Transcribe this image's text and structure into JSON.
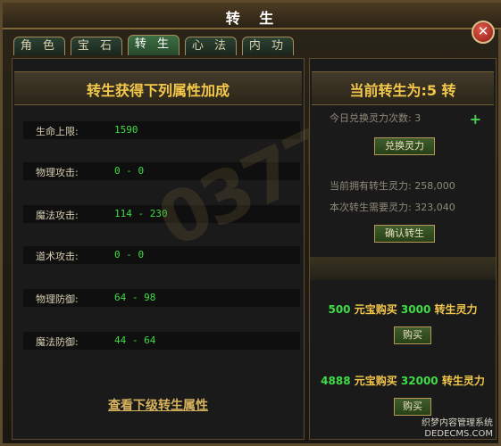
{
  "window": {
    "title": "转 生"
  },
  "tabs": [
    "角 色",
    "宝 石",
    "转 生",
    "心 法",
    "内 功"
  ],
  "left": {
    "header": "转生获得下列属性加成",
    "stats": [
      {
        "label": "生命上限:",
        "value": "1590"
      },
      {
        "label": "物理攻击:",
        "value": "0 - 0"
      },
      {
        "label": "魔法攻击:",
        "value": "114 - 230"
      },
      {
        "label": "道术攻击:",
        "value": "0 - 0"
      },
      {
        "label": "物理防御:",
        "value": "64 - 98"
      },
      {
        "label": "魔法防御:",
        "value": "44 - 64"
      }
    ],
    "link": "查看下级转生属性"
  },
  "right": {
    "header": "当前转生为:5 转",
    "daily_exchange": "今日兑换灵力次数: 3",
    "exchange_button": "兑换灵力",
    "owned": "当前拥有转生灵力: 258,000",
    "needed": "本次转生需要灵力: 323,040",
    "confirm_button": "确认转生",
    "offer1": {
      "num1": "500",
      "text1": " 元宝购买 ",
      "num2": "3000",
      "text2": " 转生灵力"
    },
    "offer2": {
      "num1": "4888",
      "text1": " 元宝购买 ",
      "num2": "32000",
      "text2": " 转生灵力"
    },
    "buy_label": "购买"
  },
  "watermark": "0377",
  "footer": {
    "line1": "织梦内容管理系统",
    "line2": "DEDECMS.COM"
  },
  "colors": {
    "accent": "#f4c84a",
    "value_green": "#3fdc45"
  }
}
